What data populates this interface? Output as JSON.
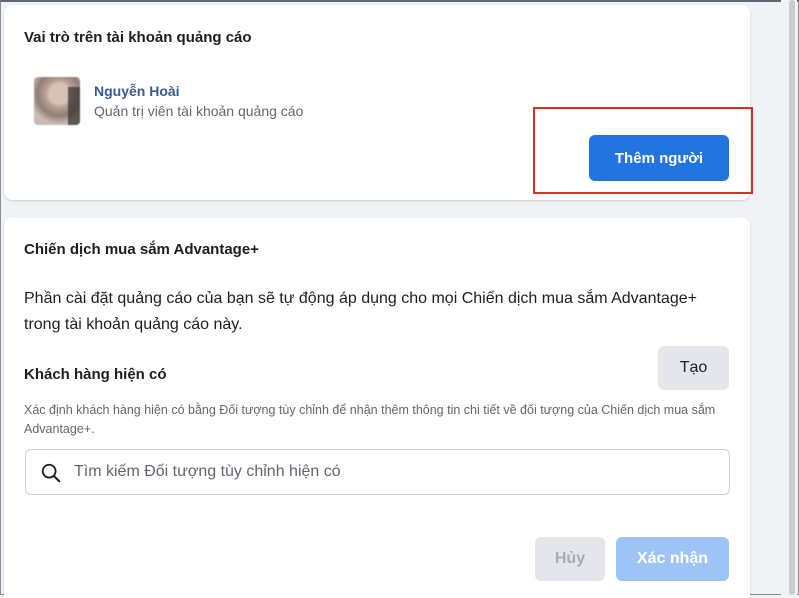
{
  "roles": {
    "title": "Vai trò trên tài khoản quảng cáo",
    "user": {
      "name": "Nguyễn Hoài",
      "role": "Quản trị viên tài khoản quảng cáo"
    },
    "add_button": "Thêm người"
  },
  "advantage": {
    "title": "Chiến dịch mua sắm Advantage+",
    "description": "Phần cài đặt quảng cáo của bạn sẽ tự động áp dụng cho mọi Chiến dịch mua sắm Advantage+ trong tài khoản quảng cáo này.",
    "existing_customers": {
      "label": "Khách hàng hiện có",
      "create_button": "Tạo",
      "help_text": "Xác định khách hàng hiện có bằng Đối tượng tùy chỉnh để nhận thêm thông tin chi tiết về đối tượng của Chiến dịch mua sắm Advantage+.",
      "search_placeholder": "Tìm kiếm Đối tượng tùy chỉnh hiện có"
    },
    "cancel_button": "Hủy",
    "confirm_button": "Xác nhận"
  },
  "colors": {
    "primary": "#2374e1",
    "primary_disabled": "#9ec4f5",
    "highlight": "#d93025",
    "link": "#385898"
  },
  "icons": {
    "search": "search-icon"
  }
}
